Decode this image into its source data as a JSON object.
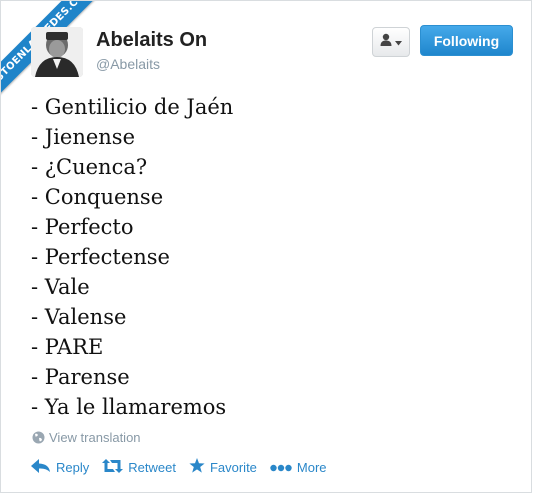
{
  "watermark": {
    "text": "VISTOENLASREDES.COM"
  },
  "profile": {
    "name": "Abelaits On",
    "handle": "@Abelaits",
    "avatar_icon": "profile-avatar"
  },
  "header_actions": {
    "user_menu_icon": "user-dropdown-icon",
    "follow_label": "Following"
  },
  "tweet": {
    "lines": [
      "- Gentilicio de Jaén",
      "- Jienense",
      "- ¿Cuenca?",
      "- Conquense",
      "- Perfecto",
      "- Perfectense",
      "- Vale",
      "- Valense",
      "- PARE",
      "- Parense",
      "- Ya le llamaremos"
    ]
  },
  "translation": {
    "label": "View translation",
    "icon": "globe-icon"
  },
  "actions": {
    "reply": "Reply",
    "retweet": "Retweet",
    "favorite": "Favorite",
    "more": "More"
  },
  "colors": {
    "accent": "#2a87c9",
    "follow_button": "#2b96dd",
    "muted": "#8899a6",
    "text": "#222222"
  }
}
